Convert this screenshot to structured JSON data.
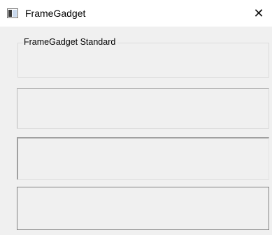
{
  "window": {
    "title": "FrameGadget",
    "close_glyph": "✕",
    "icon": "window-app-icon"
  },
  "frames": {
    "standard_label": "FrameGadget Standard"
  },
  "colors": {
    "window_background": "#f0f0f0",
    "titlebar_background": "#ffffff"
  }
}
